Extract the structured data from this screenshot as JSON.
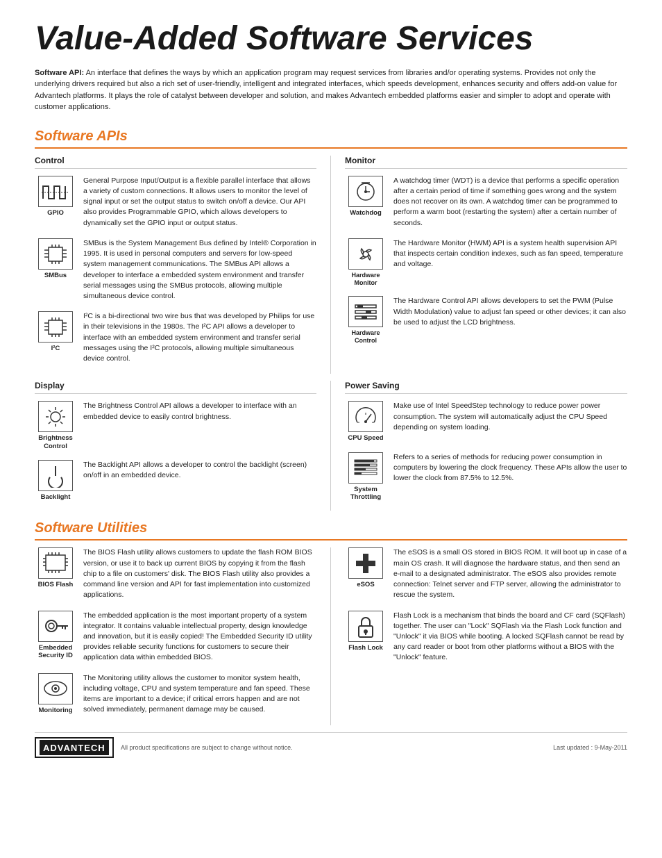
{
  "page": {
    "title": "Value-Added Software Services",
    "intro_strong": "Software API:",
    "intro_text": " An interface that defines the ways by which an application program may request services from libraries and/or operating systems. Provides not only the underlying drivers required but also a rich set of user-friendly, intelligent and integrated interfaces, which speeds development, enhances security and offers add-on value for Advantech platforms. It plays the role of catalyst between developer and solution, and makes Advantech embedded platforms easier and simpler to adopt and operate with customer applications."
  },
  "software_apis": {
    "section_title": "Software APIs",
    "control": {
      "header": "Control",
      "items": [
        {
          "id": "gpio",
          "label": "GPIO",
          "text": "General Purpose Input/Output is a flexible parallel interface that allows a variety of custom connections. It allows users to monitor the level of signal input or set the output status to switch on/off a device. Our API also provides Programmable GPIO, which allows developers to dynamically set the GPIO input or output status."
        },
        {
          "id": "smbus",
          "label": "SMBus",
          "text": "SMBus is the System Management Bus defined by Intel® Corporation in 1995. It is used in personal computers and servers for low-speed system management communications. The SMBus API allows a developer to interface a embedded system environment and transfer serial messages using the SMBus protocols, allowing multiple simultaneous device control."
        },
        {
          "id": "i2c",
          "label": "I²C",
          "text": "I²C is a bi-directional two wire bus that was developed by Philips for use in their televisions in the 1980s. The I²C API allows a developer to interface with an embedded system environment and transfer serial messages using the I²C protocols, allowing multiple simultaneous device control."
        }
      ]
    },
    "monitor": {
      "header": "Monitor",
      "items": [
        {
          "id": "watchdog",
          "label": "Watchdog",
          "text": "A watchdog timer (WDT) is a device that performs a specific operation after a certain period of time if something goes wrong and the system does not recover on its own. A watchdog timer can be programmed to perform a warm boot (restarting the system) after a certain number of seconds."
        },
        {
          "id": "hardware-monitor",
          "label": "Hardware Monitor",
          "text": "The Hardware Monitor (HWM) API is a system health supervision API that inspects certain condition indexes, such as fan speed, temperature and voltage."
        },
        {
          "id": "hardware-control",
          "label": "Hardware Control",
          "text": "The Hardware Control API allows developers to set the PWM (Pulse Width Modulation) value to adjust fan speed or other devices; it can also be used to adjust the LCD brightness."
        }
      ]
    },
    "display": {
      "header": "Display",
      "items": [
        {
          "id": "brightness",
          "label": "Brightness Control",
          "text": "The Brightness Control API allows a developer to interface with an embedded device to easily control brightness."
        },
        {
          "id": "backlight",
          "label": "Backlight",
          "text": "The Backlight API allows a developer to control the backlight (screen) on/off in an embedded device."
        }
      ]
    },
    "power_saving": {
      "header": "Power Saving",
      "items": [
        {
          "id": "cpu-speed",
          "label": "CPU Speed",
          "text": "Make use of Intel SpeedStep technology to reduce power power consumption. The system will automatically adjust the CPU Speed depending on system loading."
        },
        {
          "id": "throttling",
          "label": "System Throttling",
          "text": "Refers to a series of methods for reducing power consumption in computers by lowering the clock frequency. These APIs allow the user to lower the clock from 87.5% to 12.5%."
        }
      ]
    }
  },
  "software_utilities": {
    "section_title": "Software Utilities",
    "left_items": [
      {
        "id": "bios-flash",
        "label": "BIOS Flash",
        "text": "The BIOS Flash utility allows customers to update the flash ROM BIOS version, or use it to back up current BIOS by copying it from the flash chip to a file on customers' disk. The BIOS Flash utility also provides a command line version and API for fast implementation into customized applications."
      },
      {
        "id": "embedded-security",
        "label": "Embedded Security ID",
        "text": "The embedded application is the most important property of a system integrator. It contains valuable intellectual property, design knowledge and innovation, but it is easily copied! The Embedded Security ID utility provides reliable security functions for customers to secure their application data within embedded BIOS."
      },
      {
        "id": "monitoring",
        "label": "Monitoring",
        "text": "The Monitoring utility allows the customer to monitor system health, including voltage, CPU and system temperature and fan speed. These items are important to a device; if critical errors happen and are not solved immediately, permanent damage may be caused."
      }
    ],
    "right_items": [
      {
        "id": "esos",
        "label": "eSOS",
        "text": "The eSOS is a small OS stored in BIOS ROM. It will boot up in case of a main OS crash. It will diagnose the hardware status, and then send an e-mail to a designated administrator. The eSOS also provides remote connection: Telnet server and FTP server, allowing the administrator to rescue the system."
      },
      {
        "id": "flash-lock",
        "label": "Flash Lock",
        "text": "Flash Lock is a mechanism that binds the board and CF card (SQFlash) together. The user can \"Lock\" SQFlash via the Flash Lock function and \"Unlock\" it via BIOS while booting. A locked SQFlash cannot be read by any card reader or boot from other platforms without a BIOS with the \"Unlock\" feature."
      }
    ]
  },
  "footer": {
    "logo": "ADVANTECH",
    "note": "All product specifications are subject to change without notice.",
    "date": "Last updated : 9-May-2011"
  }
}
